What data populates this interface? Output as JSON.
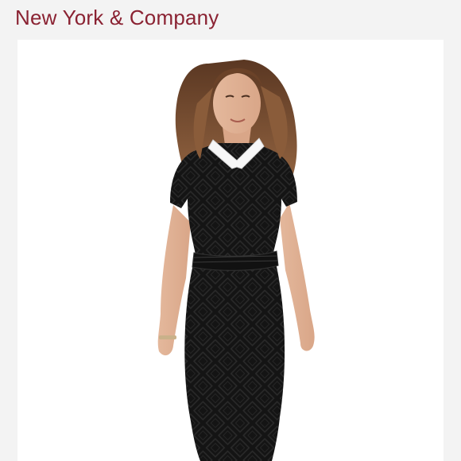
{
  "brand": {
    "name": "New York & Company",
    "color": "#8a2232"
  },
  "product_image": {
    "subject": "model wearing black lace short-sleeve sheath dress with white collar",
    "background": "#ffffff",
    "dress_color": "#141414",
    "collar_color": "#f7f7f7"
  }
}
